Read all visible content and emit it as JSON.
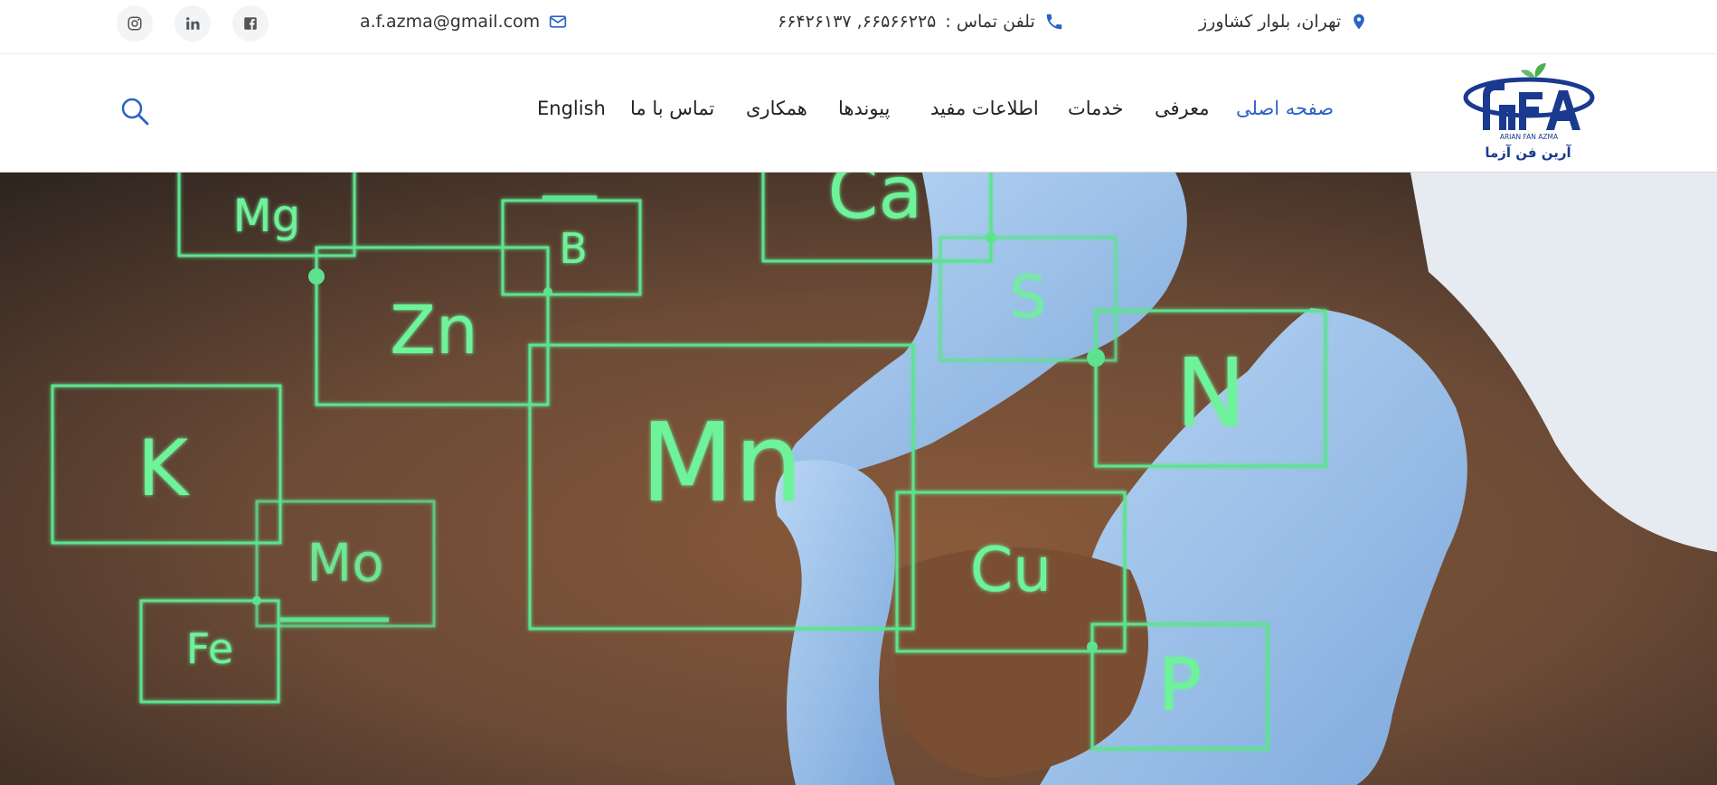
{
  "topbar": {
    "email": "a.f.azma@gmail.com",
    "phone_label": "تلفن تماس :",
    "phone_numbers": "۶۶۵۶۶۲۲۵, ۶۶۴۲۶۱۳۷",
    "address": "تهران، بلوار کشاورز",
    "social": [
      "instagram-icon",
      "linkedin-icon",
      "facebook-icon"
    ],
    "accent": "#2a63c8"
  },
  "nav": {
    "items": [
      {
        "label": "صفحه اصلی",
        "active": true
      },
      {
        "label": "معرفی",
        "active": false
      },
      {
        "label": "خدمات",
        "active": false
      },
      {
        "label": "اطلاعات مفید",
        "active": false
      },
      {
        "label": "پیوندها",
        "active": false
      },
      {
        "label": "همکاری",
        "active": false
      },
      {
        "label": "تماس با ما",
        "active": false
      },
      {
        "label": "English",
        "active": false
      }
    ]
  },
  "logo": {
    "mark": "AFA",
    "tagline": "ARIAN FAN AZMA",
    "name_fa": "آرین فن آزما"
  },
  "hero": {
    "elements": [
      "Mg",
      "Ca",
      "B",
      "Zn",
      "S",
      "N",
      "K",
      "Mn",
      "Mo",
      "Cu",
      "Fe",
      "P"
    ],
    "glow_color": "#6ef29a"
  }
}
